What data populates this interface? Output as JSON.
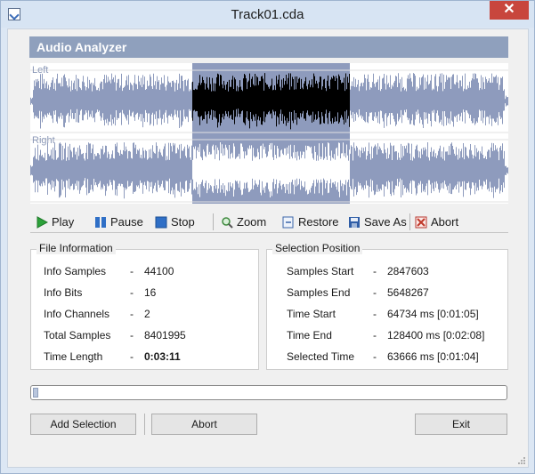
{
  "window": {
    "title": "Track01.cda",
    "close_glyph": "✕"
  },
  "header": {
    "title": "Audio Analyzer"
  },
  "waveform": {
    "left_label": "Left",
    "right_label": "Right",
    "selection_color": "#8e9bbd",
    "wave_color": "#8e9bbd"
  },
  "toolbar": {
    "play": "Play",
    "pause": "Pause",
    "stop": "Stop",
    "zoom": "Zoom",
    "restore": "Restore",
    "save_as": "Save As",
    "abort": "Abort"
  },
  "file_info": {
    "title": "File Information",
    "rows": [
      {
        "label": "Info Samples",
        "sep": "-",
        "value": "44100"
      },
      {
        "label": "Info Bits",
        "sep": "-",
        "value": "16"
      },
      {
        "label": "Info Channels",
        "sep": "-",
        "value": "2"
      },
      {
        "label": "Total Samples",
        "sep": "-",
        "value": "8401995"
      },
      {
        "label": "Time Length",
        "sep": "-",
        "value": "0:03:11"
      }
    ]
  },
  "selection": {
    "title": "Selection Position",
    "rows": [
      {
        "label": "Samples Start",
        "sep": "-",
        "value": "2847603"
      },
      {
        "label": "Samples End",
        "sep": "-",
        "value": "5648267"
      },
      {
        "label": "Time Start",
        "sep": "-",
        "value": "64734 ms [0:01:05]"
      },
      {
        "label": "Time End",
        "sep": "-",
        "value": "128400 ms [0:02:08]"
      },
      {
        "label": "Selected Time",
        "sep": "-",
        "value": "63666 ms [0:01:04]"
      }
    ]
  },
  "progress": {
    "fraction": 0.01
  },
  "buttons": {
    "add_selection": "Add Selection",
    "abort": "Abort",
    "exit": "Exit"
  }
}
